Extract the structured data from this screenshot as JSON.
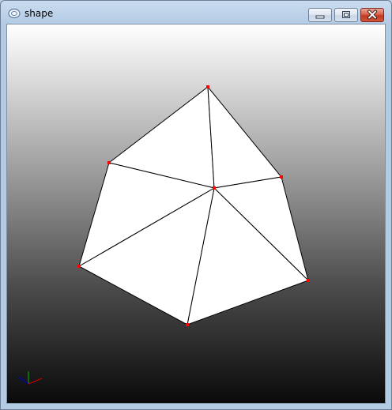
{
  "window": {
    "title": "shape"
  },
  "icons": {
    "app": "app-icon",
    "minimize": "minimize-icon",
    "maximize": "maximize-icon",
    "close": "close-icon"
  },
  "scene": {
    "background": "vertical-gradient",
    "gradient_colors": [
      "#ffffff",
      "#000000"
    ],
    "face_color": "#ffffff",
    "edge_color": "#000000",
    "vertex_color": "#ff0000",
    "axis_colors": [
      "#00a000",
      "#d00000",
      "#0000c0"
    ]
  }
}
